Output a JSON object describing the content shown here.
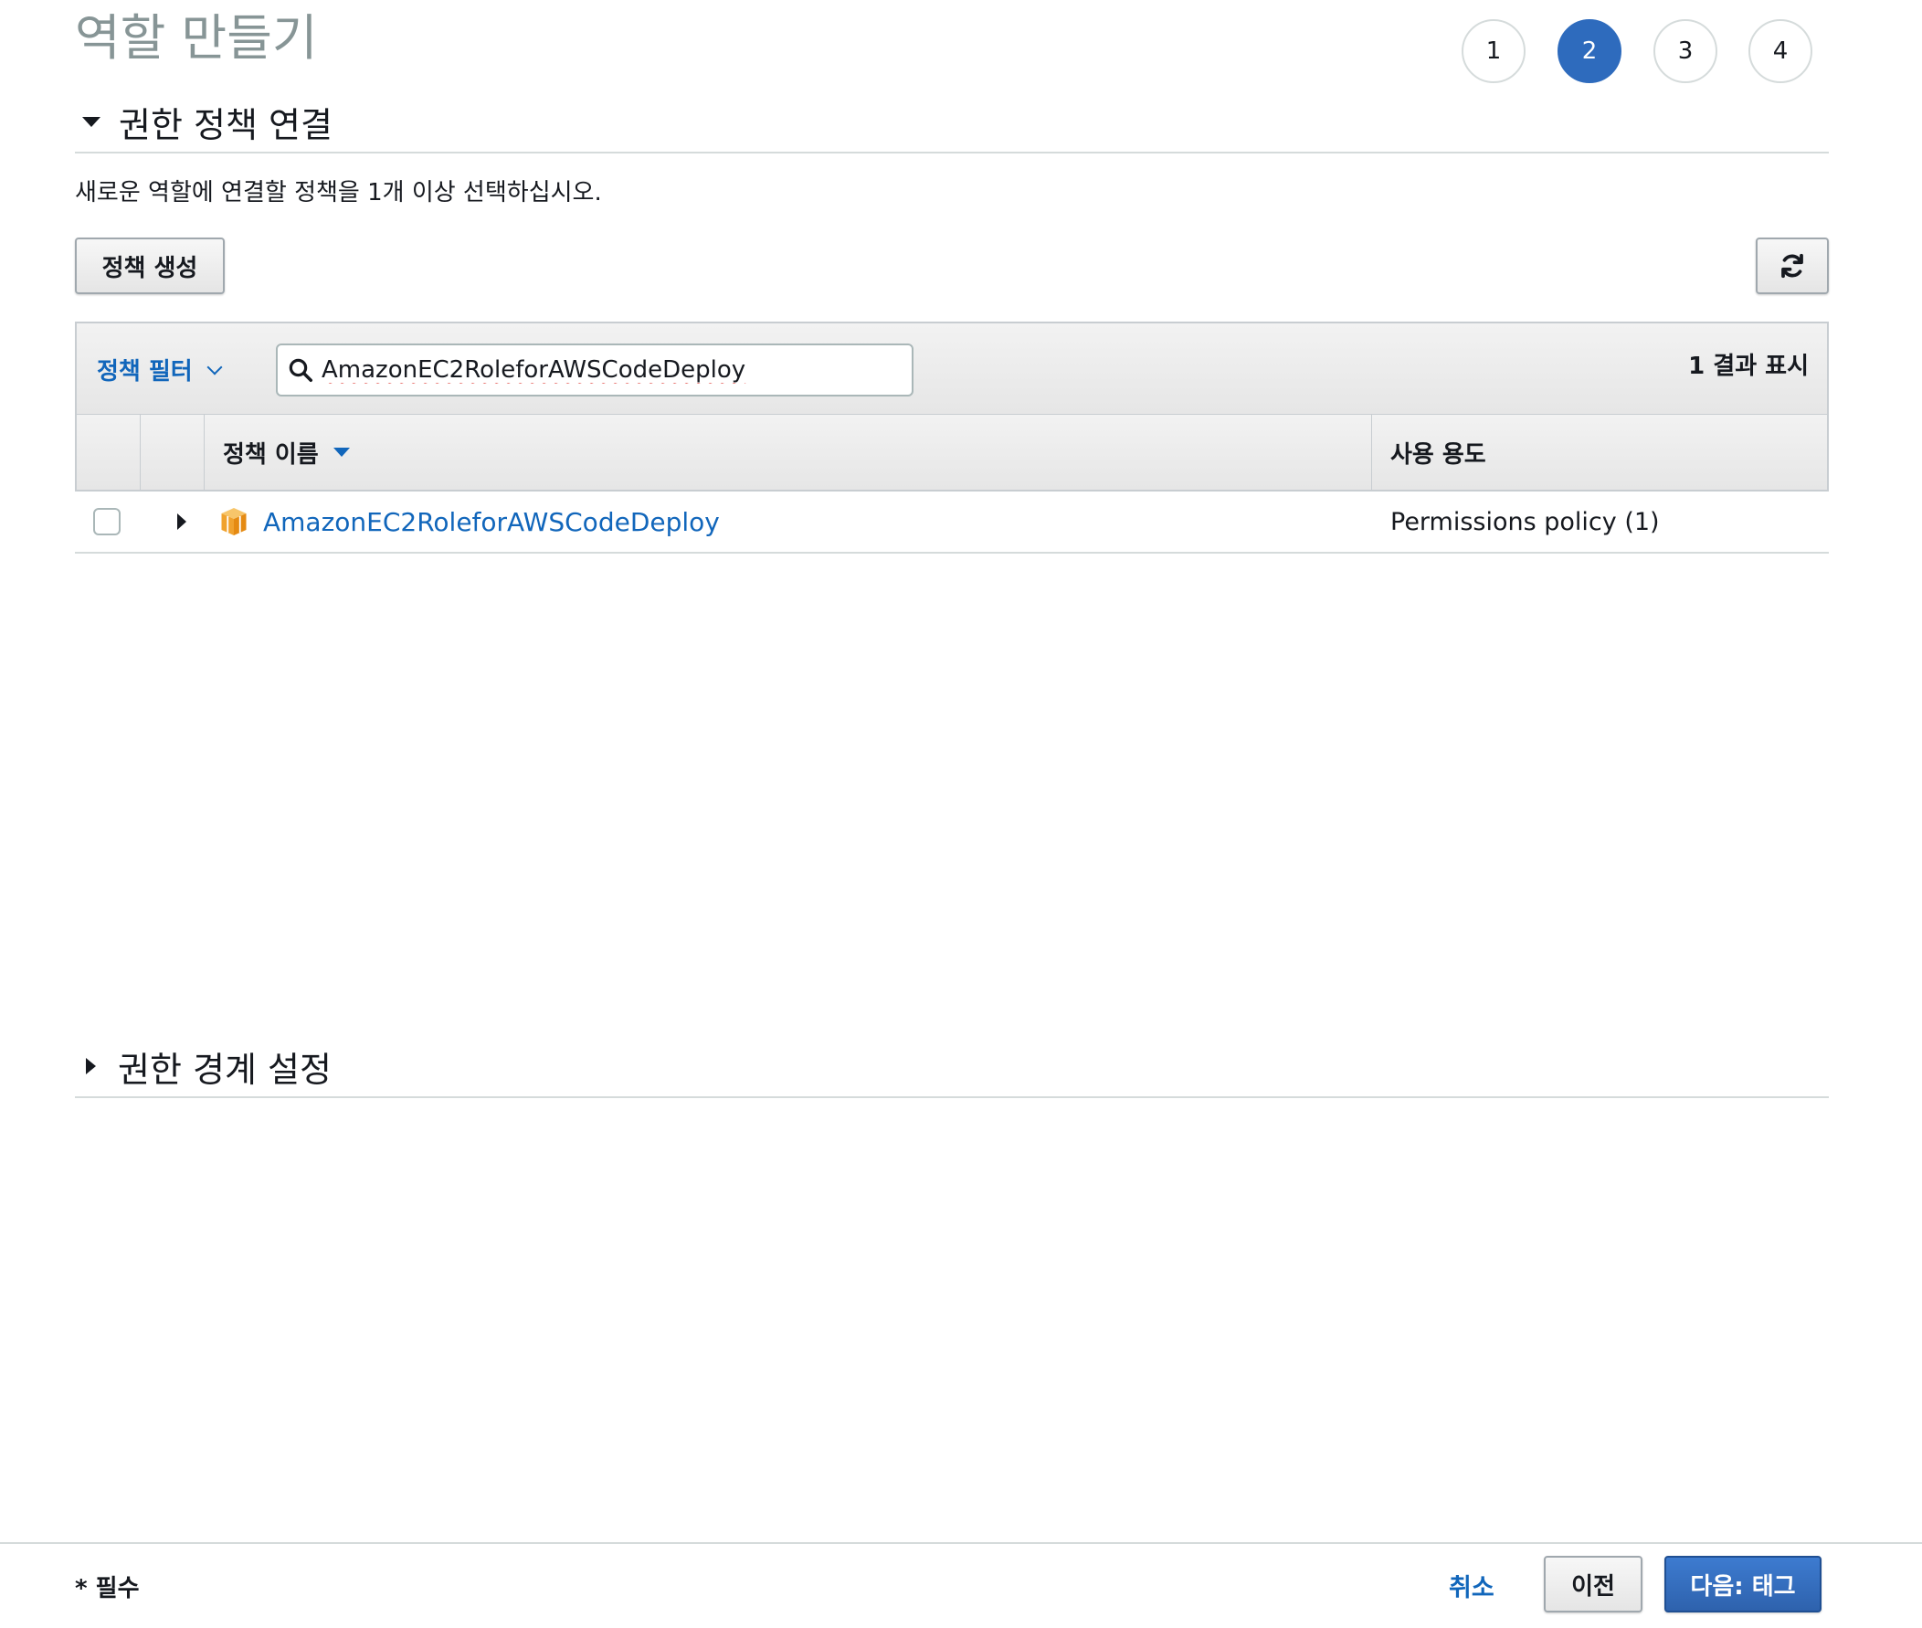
{
  "page": {
    "title": "역할 만들기"
  },
  "steps": [
    {
      "label": "1"
    },
    {
      "label": "2"
    },
    {
      "label": "3"
    },
    {
      "label": "4"
    }
  ],
  "permissions_section": {
    "title": "권한 정책 연결",
    "description": "새로운 역할에 연결할 정책을 1개 이상 선택하십시오.",
    "create_policy_label": "정책 생성",
    "refresh_icon": "refresh-icon",
    "filter_label": "정책 필터",
    "search": {
      "value": "AmazonEC2RoleforAWSCodeDeploy"
    },
    "result_count": "1 결과 표시",
    "table": {
      "columns": {
        "name": "정책 이름",
        "usage": "사용 용도"
      },
      "rows": [
        {
          "name": "AmazonEC2RoleforAWSCodeDeploy",
          "usage": "Permissions policy (1)",
          "icon": "aws-managed-policy-icon"
        }
      ]
    }
  },
  "boundary_section": {
    "title": "권한 경계 설정"
  },
  "footer": {
    "required_label": "* 필수",
    "cancel_label": "취소",
    "previous_label": "이전",
    "next_label": "다음: 태그"
  },
  "colors": {
    "accent": "#2e6bbd",
    "link": "#1166bb",
    "policy_icon": "#f0a22e"
  }
}
